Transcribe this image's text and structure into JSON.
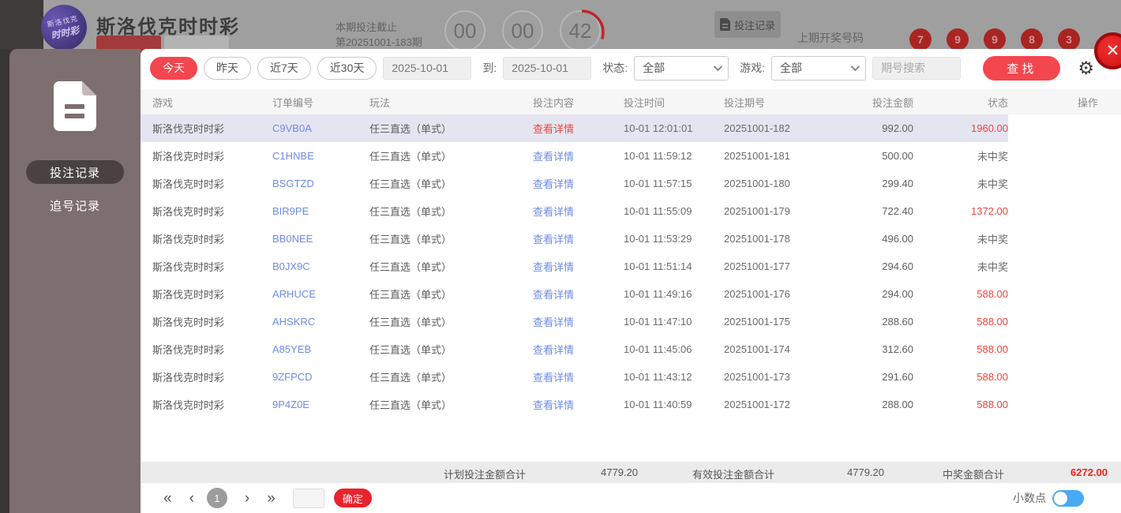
{
  "header": {
    "logo_line1": "斯洛伐克",
    "logo_line2": "时时彩",
    "title": "斯洛伐克时时彩",
    "deadline_label": "本期投注截止",
    "period_label": "第20251001-183期",
    "countdown": {
      "hours": "00",
      "minutes": "00",
      "seconds": "42"
    },
    "bet_record_button": "投注记录",
    "last_draw_label": "上期开奖号码",
    "last_draw_numbers": [
      "7",
      "9",
      "9",
      "8",
      "3"
    ]
  },
  "sidebar": {
    "items": [
      {
        "label": "投注记录",
        "active": true
      },
      {
        "label": "追号记录",
        "active": false
      }
    ]
  },
  "filters": {
    "quick_ranges": [
      "今天",
      "昨天",
      "近7天",
      "近30天"
    ],
    "active_range": "今天",
    "date_from": "2025-10-01",
    "to_label": "到:",
    "date_to": "2025-10-01",
    "status_label": "状态:",
    "status_value": "全部",
    "game_label": "游戏:",
    "game_value": "全部",
    "search_placeholder": "期号搜索",
    "search_button": "查找"
  },
  "table": {
    "columns": [
      "游戏",
      "订单编号",
      "玩法",
      "投注内容",
      "投注时间",
      "投注期号",
      "投注金额",
      "状态",
      "操作"
    ],
    "detail_link": "查看详情",
    "rows": [
      {
        "game": "斯洛伐克时时彩",
        "order": "C9VB0A",
        "play": "任三直选（单式）",
        "time": "10-01 12:01:01",
        "period": "20251001-182",
        "amount": "992.00",
        "status": "1960.00",
        "win": true,
        "selected": true
      },
      {
        "game": "斯洛伐克时时彩",
        "order": "C1HNBE",
        "play": "任三直选（单式）",
        "time": "10-01 11:59:12",
        "period": "20251001-181",
        "amount": "500.00",
        "status": "未中奖",
        "win": false,
        "selected": false
      },
      {
        "game": "斯洛伐克时时彩",
        "order": "BSGTZD",
        "play": "任三直选（单式）",
        "time": "10-01 11:57:15",
        "period": "20251001-180",
        "amount": "299.40",
        "status": "未中奖",
        "win": false,
        "selected": false
      },
      {
        "game": "斯洛伐克时时彩",
        "order": "BIR9PE",
        "play": "任三直选（单式）",
        "time": "10-01 11:55:09",
        "period": "20251001-179",
        "amount": "722.40",
        "status": "1372.00",
        "win": true,
        "selected": false
      },
      {
        "game": "斯洛伐克时时彩",
        "order": "BB0NEE",
        "play": "任三直选（单式）",
        "time": "10-01 11:53:29",
        "period": "20251001-178",
        "amount": "496.00",
        "status": "未中奖",
        "win": false,
        "selected": false
      },
      {
        "game": "斯洛伐克时时彩",
        "order": "B0JX9C",
        "play": "任三直选（单式）",
        "time": "10-01 11:51:14",
        "period": "20251001-177",
        "amount": "294.60",
        "status": "未中奖",
        "win": false,
        "selected": false
      },
      {
        "game": "斯洛伐克时时彩",
        "order": "ARHUCE",
        "play": "任三直选（单式）",
        "time": "10-01 11:49:16",
        "period": "20251001-176",
        "amount": "294.00",
        "status": "588.00",
        "win": true,
        "selected": false
      },
      {
        "game": "斯洛伐克时时彩",
        "order": "AHSKRC",
        "play": "任三直选（单式）",
        "time": "10-01 11:47:10",
        "period": "20251001-175",
        "amount": "288.60",
        "status": "588.00",
        "win": true,
        "selected": false
      },
      {
        "game": "斯洛伐克时时彩",
        "order": "A85YEB",
        "play": "任三直选（单式）",
        "time": "10-01 11:45:06",
        "period": "20251001-174",
        "amount": "312.60",
        "status": "588.00",
        "win": true,
        "selected": false
      },
      {
        "game": "斯洛伐克时时彩",
        "order": "9ZFPCD",
        "play": "任三直选（单式）",
        "time": "10-01 11:43:12",
        "period": "20251001-173",
        "amount": "291.60",
        "status": "588.00",
        "win": true,
        "selected": false
      },
      {
        "game": "斯洛伐克时时彩",
        "order": "9P4Z0E",
        "play": "任三直选（单式）",
        "time": "10-01 11:40:59",
        "period": "20251001-172",
        "amount": "288.00",
        "status": "588.00",
        "win": true,
        "selected": false
      }
    ]
  },
  "summary": {
    "plan_label": "计划投注金额合计",
    "plan_value": "4779.20",
    "valid_label": "有效投注金额合计",
    "valid_value": "4779.20",
    "win_label": "中奖金额合计",
    "win_value": "6272.00"
  },
  "pagination": {
    "current_page": "1",
    "confirm_button": "确定"
  },
  "footer_toggle": {
    "label": "小数点",
    "state": "on"
  },
  "colors": {
    "accent_red": "#f4464e",
    "link_blue": "#6e8be6",
    "win_red": "#f0433a",
    "selected_row": "#e5e5f1",
    "sidebar_brown": "#7d6f6f",
    "toggle_blue": "#4aa9f4",
    "ball_red": "#a92522"
  }
}
